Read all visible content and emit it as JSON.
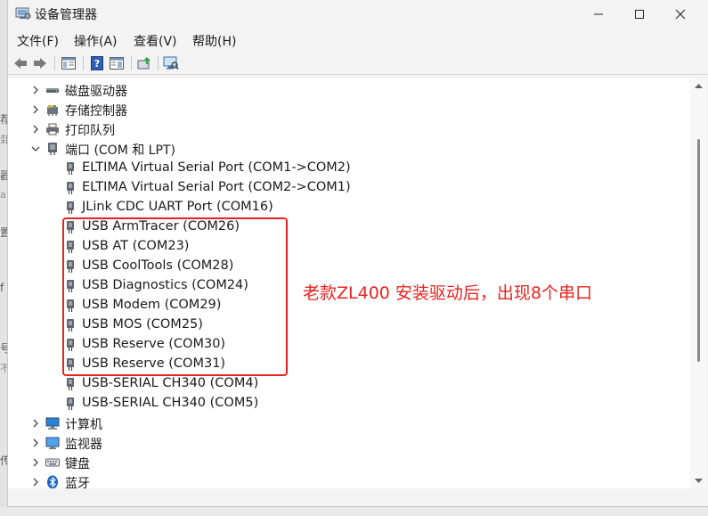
{
  "window": {
    "title": "设备管理器"
  },
  "menu": [
    {
      "label": "文件(F)"
    },
    {
      "label": "操作(A)"
    },
    {
      "label": "查看(V)"
    },
    {
      "label": "帮助(H)"
    }
  ],
  "tree": {
    "nodes": [
      {
        "label": "磁盘驱动器",
        "expanded": false,
        "icon": "disk-drive-icon"
      },
      {
        "label": "存储控制器",
        "expanded": false,
        "icon": "storage-controller-icon"
      },
      {
        "label": "打印队列",
        "expanded": false,
        "icon": "printer-icon"
      },
      {
        "label": "端口 (COM 和 LPT)",
        "expanded": true,
        "icon": "port-icon"
      },
      {
        "label": "计算机",
        "expanded": false,
        "icon": "computer-icon"
      },
      {
        "label": "监视器",
        "expanded": false,
        "icon": "monitor-icon"
      },
      {
        "label": "键盘",
        "expanded": false,
        "icon": "keyboard-icon"
      },
      {
        "label": "蓝牙",
        "expanded": false,
        "icon": "bluetooth-icon"
      }
    ],
    "ports": [
      {
        "label": "ELTIMA Virtual Serial Port (COM1->COM2)"
      },
      {
        "label": "ELTIMA Virtual Serial Port (COM2->COM1)"
      },
      {
        "label": "JLink CDC UART Port (COM16)"
      },
      {
        "label": "USB ArmTracer (COM26)"
      },
      {
        "label": "USB AT (COM23)"
      },
      {
        "label": "USB CoolTools (COM28)"
      },
      {
        "label": "USB Diagnostics (COM24)"
      },
      {
        "label": "USB Modem (COM29)"
      },
      {
        "label": "USB MOS (COM25)"
      },
      {
        "label": "USB Reserve (COM30)"
      },
      {
        "label": "USB Reserve (COM31)"
      },
      {
        "label": "USB-SERIAL CH340 (COM4)"
      },
      {
        "label": "USB-SERIAL CH340 (COM5)"
      }
    ]
  },
  "annotation": {
    "text": "老款ZL400 安装驱动后，出现8个串口",
    "color": "#e8231f"
  },
  "background_edge": [
    "荐",
    "卦",
    "器",
    "a",
    "置",
    "f",
    "号",
    "不",
    "传"
  ]
}
